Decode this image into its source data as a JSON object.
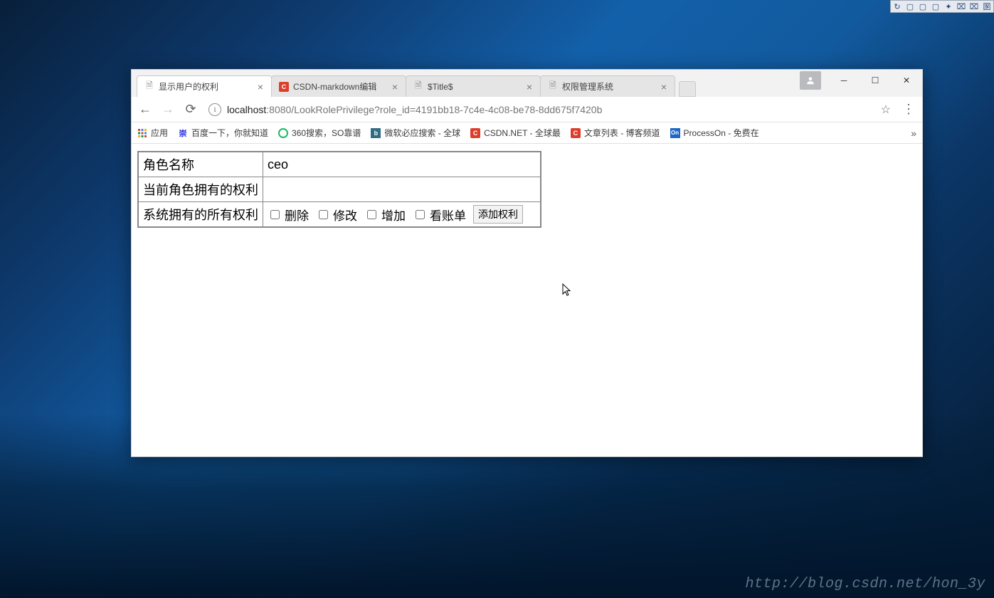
{
  "sys_tray": {
    "icons": [
      "↻",
      "▢",
      "▢",
      "▢",
      "✦",
      "⌧",
      "⌧",
      "圂"
    ]
  },
  "browser": {
    "tabs": [
      {
        "title": "显示用户的权利",
        "favicon": "file",
        "active": true
      },
      {
        "title": "CSDN-markdown编辑",
        "favicon": "csdn",
        "active": false
      },
      {
        "title": "$Title$",
        "favicon": "file",
        "active": false
      },
      {
        "title": "权限管理系统",
        "favicon": "file",
        "active": false
      }
    ],
    "url": {
      "host": "localhost",
      "rest": ":8080/LookRolePrivilege?role_id=4191bb18-7c4e-4c08-be78-8dd675f7420b"
    },
    "bookmarks": {
      "apps_label": "应用",
      "items": [
        {
          "label": "百度一下，你就知道",
          "favicon": "baidu"
        },
        {
          "label": "360搜索，SO靠谱",
          "favicon": "360"
        },
        {
          "label": "微软必应搜索 - 全球",
          "favicon": "bing"
        },
        {
          "label": "CSDN.NET - 全球最",
          "favicon": "csdn"
        },
        {
          "label": "文章列表 - 博客频道",
          "favicon": "csdn"
        },
        {
          "label": "ProcessOn - 免费在",
          "favicon": "po"
        }
      ]
    }
  },
  "page": {
    "rows": {
      "role_name_label": "角色名称",
      "role_name_value": "ceo",
      "current_priv_label": "当前角色拥有的权利",
      "current_priv_value": "",
      "all_priv_label": "系统拥有的所有权利"
    },
    "checkboxes": [
      {
        "label": "删除"
      },
      {
        "label": "修改"
      },
      {
        "label": "增加"
      },
      {
        "label": "看账单"
      }
    ],
    "add_button_label": "添加权利"
  },
  "watermark": "http://blog.csdn.net/hon_3y"
}
